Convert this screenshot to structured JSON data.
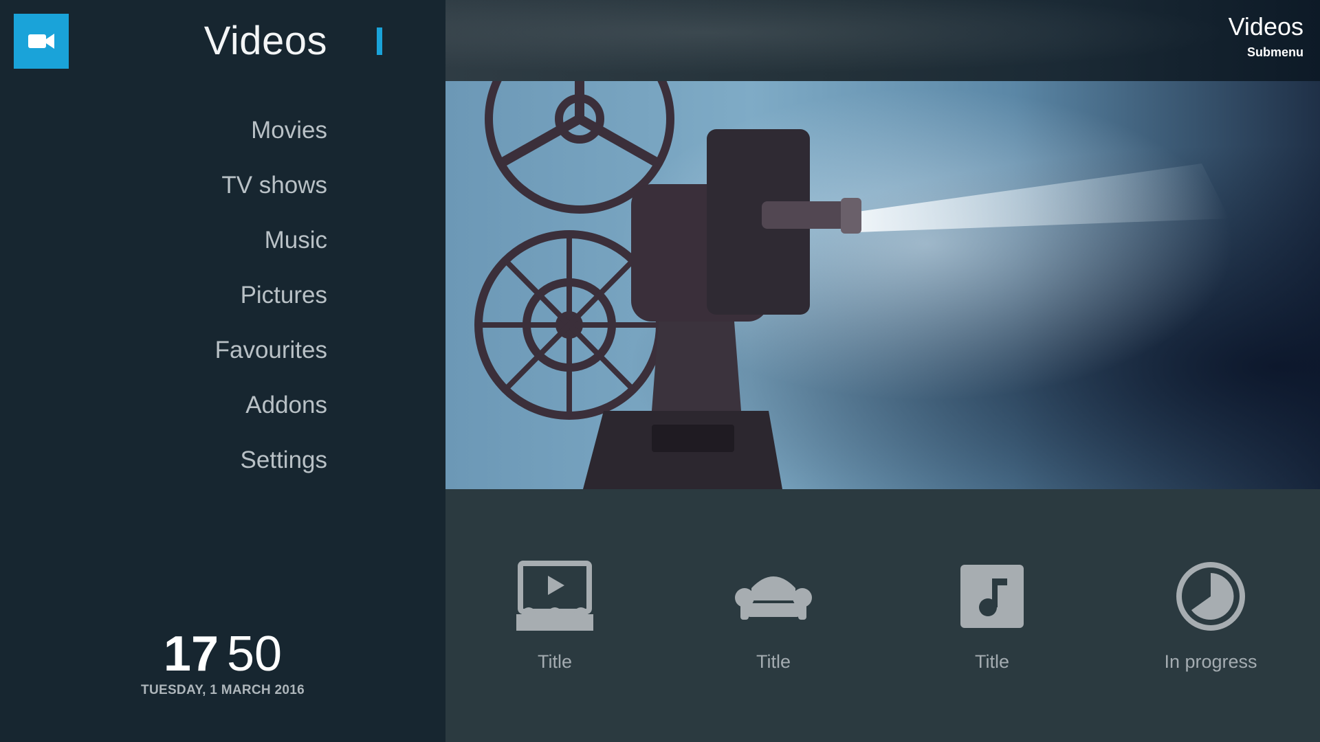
{
  "app": {
    "accent": "#1aa3d9"
  },
  "sidebar": {
    "logo_icon": "video-camera-icon",
    "section_title": "Videos",
    "items": [
      {
        "label": "Movies"
      },
      {
        "label": "TV shows"
      },
      {
        "label": "Music"
      },
      {
        "label": "Pictures"
      },
      {
        "label": "Favourites"
      },
      {
        "label": "Addons"
      },
      {
        "label": "Settings"
      }
    ],
    "clock": {
      "hours": "17",
      "minutes": "50"
    },
    "date": "TUESDAY, 1 MARCH 2016"
  },
  "header": {
    "title": "Videos",
    "subtitle": "Submenu"
  },
  "fanart": {
    "subject": "film-projector-image"
  },
  "submenu": {
    "tiles": [
      {
        "label": "Title",
        "icon": "cinema-play-icon"
      },
      {
        "label": "Title",
        "icon": "armchair-icon"
      },
      {
        "label": "Title",
        "icon": "music-note-icon"
      },
      {
        "label": "In progress",
        "icon": "progress-pie-icon"
      }
    ]
  }
}
